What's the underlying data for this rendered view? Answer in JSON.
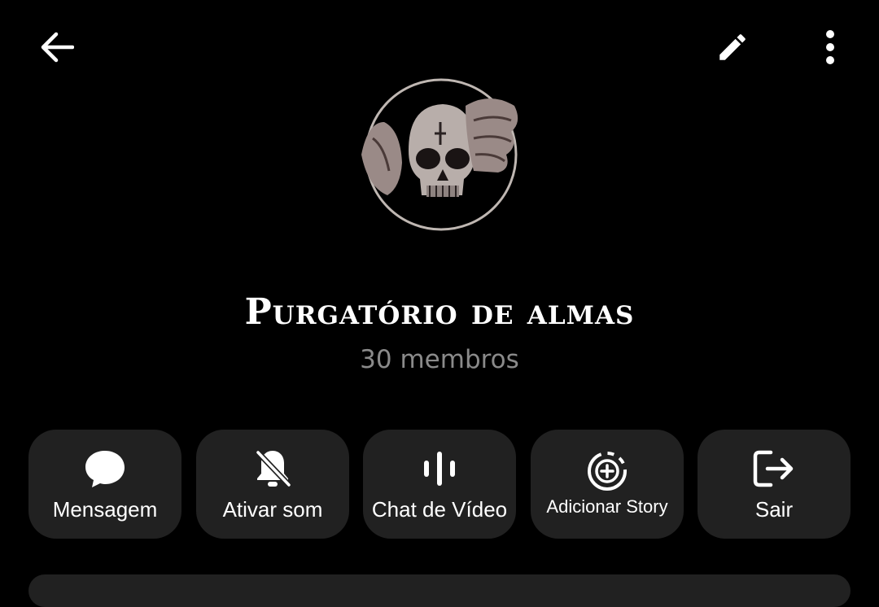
{
  "header": {
    "back_icon": "arrow-left-icon",
    "edit_icon": "pencil-icon",
    "more_icon": "more-vertical-icon"
  },
  "group": {
    "name": "Purgatório de almas",
    "members": "30 membros",
    "avatar": "skull-hand-avatar"
  },
  "actions": [
    {
      "label": "Mensagem",
      "icon": "chat-bubble-icon"
    },
    {
      "label": "Ativar som",
      "icon": "bell-off-icon"
    },
    {
      "label": "Chat de Vídeo",
      "icon": "audio-bars-icon"
    },
    {
      "label": "Adicionar Story",
      "icon": "add-story-icon"
    },
    {
      "label": "Sair",
      "icon": "logout-icon"
    }
  ]
}
